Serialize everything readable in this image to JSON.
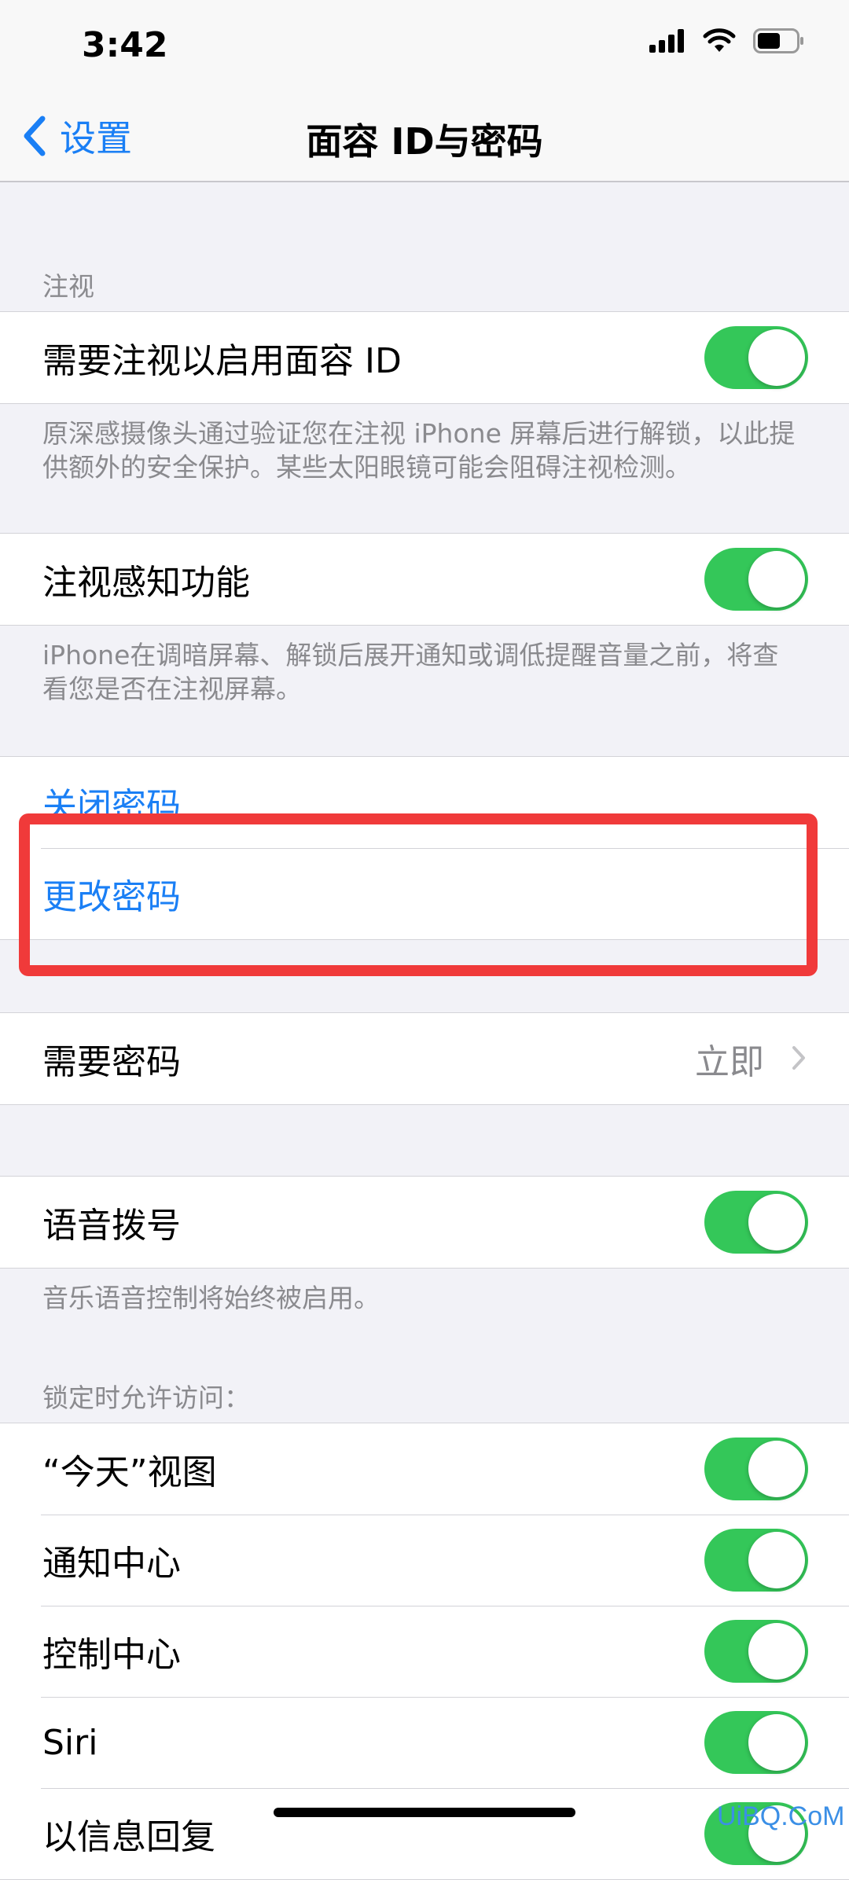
{
  "status_bar": {
    "time": "3:42"
  },
  "nav": {
    "back_label": "设置",
    "title": "面容 ID与密码"
  },
  "attention": {
    "header": "注视",
    "require_label": "需要注视以启用面容 ID",
    "require_footer": "原深感摄像头通过验证您在注视 iPhone 屏幕后进行解锁，以此提供额外的安全保护。某些太阳眼镜可能会阻碍注视检测。",
    "aware_label": "注视感知功能",
    "aware_footer": "iPhone在调暗屏幕、解锁后展开通知或调低提醒音量之前，将查看您是否在注视屏幕。"
  },
  "passcode": {
    "turn_off_label": "关闭密码",
    "change_label": "更改密码"
  },
  "require_passcode": {
    "label": "需要密码",
    "value": "立即"
  },
  "voice_dial": {
    "label": "语音拨号",
    "footer": "音乐语音控制将始终被启用。"
  },
  "locked_access": {
    "header": "锁定时允许访问：",
    "items": [
      {
        "label": "“今天”视图"
      },
      {
        "label": "通知中心"
      },
      {
        "label": "控制中心"
      },
      {
        "label": "Siri"
      },
      {
        "label": "以信息回复"
      }
    ]
  },
  "colors": {
    "accent": "#1a7ff5",
    "toggle_on": "#34c759",
    "highlight": "#f03a3a"
  },
  "toggles_on": true,
  "watermark": "UiBQ.CoM"
}
